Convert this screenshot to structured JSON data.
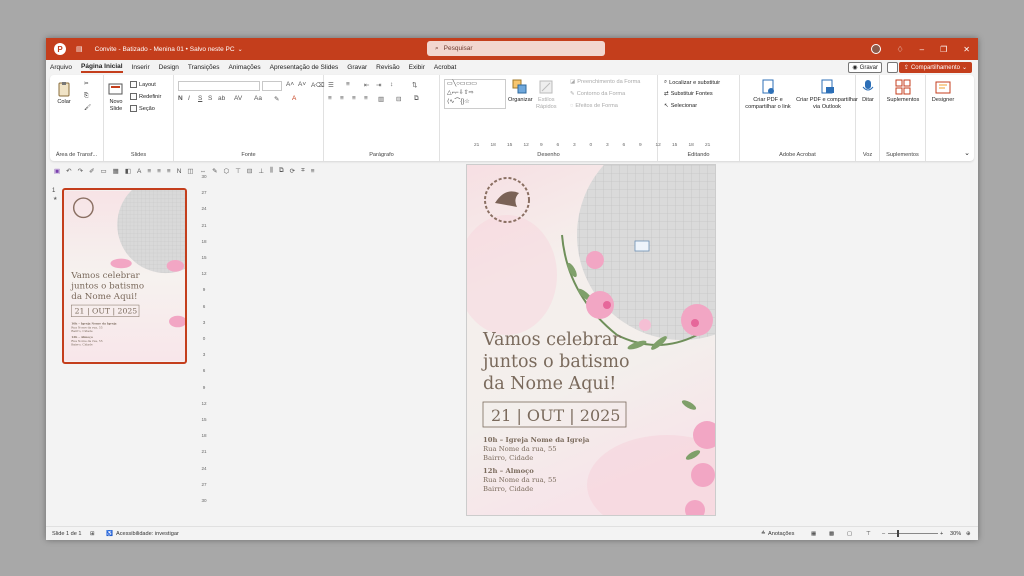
{
  "window": {
    "doc_title": "Convite - Batizado - Menina 01 • Salvo neste PC",
    "search_placeholder": "Pesquisar",
    "accent": "#c43e1c"
  },
  "menu": {
    "tabs": [
      "Arquivo",
      "Página Inicial",
      "Inserir",
      "Design",
      "Transições",
      "Animações",
      "Apresentação de Slides",
      "Gravar",
      "Revisão",
      "Exibir",
      "Acrobat"
    ],
    "gravar": "Gravar",
    "share": "Compartilhamento"
  },
  "ribbon": {
    "groups": {
      "clipboard": "Área de Transf...",
      "slides": "Slides",
      "font": "Fonte",
      "paragraph": "Parágrafo",
      "drawing": "Desenho",
      "editing": "Editando",
      "acrobat": "Adobe Acrobat",
      "voice": "Voz",
      "addins": "Suplementos"
    },
    "paste": "Colar",
    "new_slide_1": "Novo",
    "new_slide_2": "Slide",
    "layout": "Layout",
    "reset": "Redefinir",
    "section": "Seção",
    "arrange": "Organizar",
    "quick_styles_1": "Estilos",
    "quick_styles_2": "Rápidos",
    "shape_fill": "Preenchimento da Forma",
    "shape_outline": "Contorno da Forma",
    "shape_effects": "Efeitos de Forma",
    "find_replace": "Localizar e substituir",
    "replace_fonts": "Substituir Fontes",
    "select": "Selecionar",
    "create_pdf_1": "Criar PDF e",
    "create_pdf_2": "compartilhar o link",
    "create_pdf_outlook_1": "Criar PDF e compartilhar",
    "create_pdf_outlook_2": "via Outlook",
    "dictate": "Ditar",
    "addins": "Suplementos",
    "designer": "Designer"
  },
  "rulers": {
    "horizontal": [
      "21",
      "18",
      "15",
      "12",
      "9",
      "6",
      "3",
      "0",
      "3",
      "6",
      "9",
      "12",
      "15",
      "18",
      "21"
    ],
    "vertical": [
      "30",
      "27",
      "24",
      "21",
      "18",
      "15",
      "12",
      "9",
      "6",
      "3",
      "0",
      "3",
      "6",
      "9",
      "12",
      "15",
      "18",
      "21",
      "24",
      "27",
      "30"
    ]
  },
  "thumbnail": {
    "slide_number": "1",
    "star": "★"
  },
  "slide": {
    "headline_1": "Vamos celebrar",
    "headline_2": "juntos o batismo",
    "headline_3": "da Nome Aqui!",
    "date": "21 | OUT | 2025",
    "event1_title": "10h – Igreja Nome da Igreja",
    "event1_line1": "Rua Nome da rua, 55",
    "event1_line2": "Bairro, Cidade",
    "event2_title": "12h – Almoço",
    "event2_line1": "Rua Nome da rua, 55",
    "event2_line2": "Bairro, Cidade",
    "text_color": "#7a6a5c",
    "flower_pink": "#f2a6c4"
  },
  "status": {
    "slide_of": "Slide 1 de 1",
    "accessibility": "Acessibilidade: investigar",
    "notes": "Anotações",
    "zoom": "30%"
  }
}
